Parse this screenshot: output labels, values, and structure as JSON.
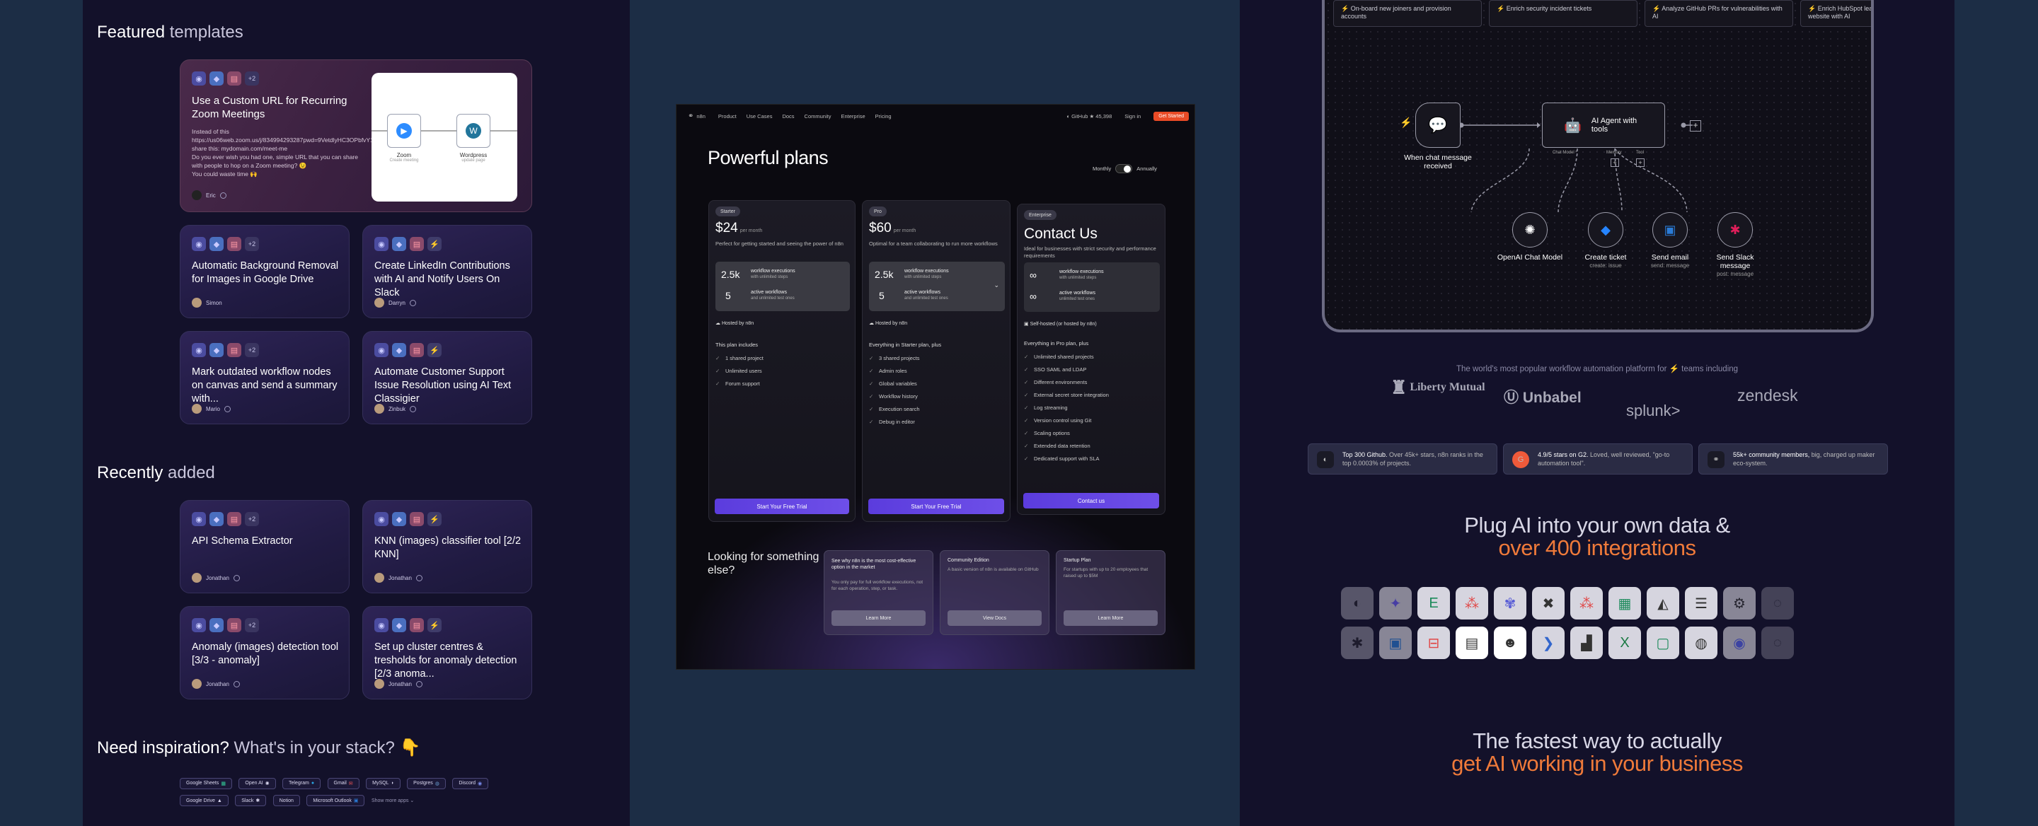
{
  "left": {
    "featured_heading": {
      "bold": "Featured",
      "rest": " templates"
    },
    "featured_card": {
      "more": "+2",
      "title": "Use a Custom URL for Recurring Zoom Meetings",
      "body": [
        "Instead of this https://us06web.zoom.us/j/834994293287pwd=9VetdlyHC3OPbfvY1i7eHC9ID46ABE.1",
        "share this: mydomain.com/meet-me",
        "Do you ever wish you had one, simple URL that you can share with people to hop on a Zoom meeting? 😉",
        "You could waste time 🙌"
      ],
      "user": "Eric",
      "nodes": [
        {
          "name": "Zoom",
          "sub": "Create meeting"
        },
        {
          "name": "Wordpress",
          "sub": "update page"
        }
      ]
    },
    "featured_cards": [
      {
        "more": "+2",
        "title": "Automatic Background Removal for Images in Google Drive",
        "user": "Simon"
      },
      {
        "more": "",
        "title": "Create LinkedIn Contributions with AI and Notify Users On Slack",
        "user": "Darryn"
      },
      {
        "more": "+2",
        "title": "Mark outdated workflow nodes on canvas and send a summary with...",
        "user": "Mario"
      },
      {
        "more": "",
        "title": "Automate Customer Support Issue Resolution using AI Text Classigier",
        "user": "Zinbuk"
      }
    ],
    "recent_heading": {
      "bold": "Recently",
      "rest": " added"
    },
    "recent_cards": [
      {
        "more": "+2",
        "title": "API Schema Extractor",
        "user": "Jonathan"
      },
      {
        "more": "",
        "title": "KNN (images) classifier tool [2/2 KNN]",
        "user": "Jonathan"
      },
      {
        "more": "+2",
        "title": "Anomaly (images) detection tool [3/3 - anomaly]",
        "user": "Jonathan"
      },
      {
        "more": "",
        "title": "Set up cluster centres & tresholds for anomaly detection [2/3 anoma...",
        "user": "Jonathan"
      }
    ],
    "inspiration_heading": {
      "bold": "Need inspiration?",
      "rest": " What's in your stack? 👇"
    },
    "tags": [
      "Google Sheets",
      "Open AI",
      "Telegram",
      "Gmail",
      "MySQL",
      "Postgres",
      "Discord",
      "Google Drive",
      "Slack",
      "Notion",
      "Microsoft Outlook"
    ],
    "show_more": "Show more apps"
  },
  "middle": {
    "nav": {
      "brand": "n8n",
      "links": [
        "Product",
        "Use Cases",
        "Docs",
        "Community",
        "Enterprise",
        "Pricing"
      ],
      "github": "GitHub ★ 45,398",
      "signin": "Sign in",
      "cta": "Get Started"
    },
    "title": "Powerful plans",
    "toggle": {
      "monthly": "Monthly",
      "annually": "Annually"
    },
    "plans": [
      {
        "badge": "Starter",
        "price": "$24",
        "per": "per month",
        "desc": "Perfect for getting started and seeing the power of n8n",
        "exec": "2.5k",
        "exec_label": "workflow executions",
        "exec_sub": "with unlimited steps",
        "active": "5",
        "active_label": "active workflows",
        "active_sub": "and unlimited test ones",
        "hosted": "Hosted by n8n",
        "feat_head": "This plan includes",
        "features": [
          "1 shared project",
          "Unlimited users",
          "Forum support"
        ],
        "cta": "Start Your Free Trial"
      },
      {
        "badge": "Pro",
        "price": "$60",
        "per": "per month",
        "desc": "Optimal for a team collaborating to run more workflows",
        "exec": "2.5k",
        "exec_label": "workflow executions",
        "exec_sub": "with unlimited steps",
        "active": "5",
        "active_label": "active workflows",
        "active_sub": "and unlimited test ones",
        "hosted": "Hosted by n8n",
        "feat_head": "Everything in Starter plan, plus",
        "features": [
          "3 shared projects",
          "Admin roles",
          "Global variables",
          "Workflow history",
          "Execution search",
          "Debug in editor"
        ],
        "cta": "Start Your Free Trial"
      },
      {
        "badge": "Enterprise",
        "price": "Contact Us",
        "per": "",
        "desc": "Ideal for businesses with strict security and performance requirements",
        "exec": "∞",
        "exec_label": "workflow executions",
        "exec_sub": "with unlimited steps",
        "active": "∞",
        "active_label": "active workflows",
        "active_sub": "unlimited test ones",
        "hosted": "Self-hosted (or hosted by n8n)",
        "feat_head": "Everything in Pro plan, plus",
        "features": [
          "Unlimited shared projects",
          "SSO SAML and LDAP",
          "Different environments",
          "External secret store integration",
          "Log streaming",
          "Version control using Git",
          "Scaling options",
          "Extended data retention",
          "Dedicated support with SLA"
        ],
        "cta": "Contact us"
      }
    ],
    "looking": "Looking for something else?",
    "alternatives": [
      {
        "title": "See why n8n is the most cost-effective option in the market",
        "desc": "You only pay for full workflow executions, not for each operation, step, or task.",
        "cta": "Learn More"
      },
      {
        "title": "Community Edition",
        "desc": "A basic version of n8n is available on GitHub",
        "cta": "View Docs"
      },
      {
        "title": "Startup Plan",
        "desc": "For startups with up to 20 employees that raised up to $5M",
        "cta": "Learn More"
      }
    ]
  },
  "right": {
    "templates": [
      "⚡ On-board new joiners and provision accounts",
      "⚡ Enrich security incident tickets",
      "⚡ Analyze GitHub PRs for vulnerabilities with AI",
      "⚡ Enrich HubSpot leads by analyzing their website with AI"
    ],
    "workflow": {
      "trigger": "When chat message received",
      "agent": "AI Agent with tools",
      "ports": [
        "Chat Model *",
        "Memory",
        "Tool"
      ],
      "tools": [
        {
          "name": "OpenAI Chat Model",
          "sub": ""
        },
        {
          "name": "Create ticket",
          "sub": "create: issue"
        },
        {
          "name": "Send email",
          "sub": "send: message"
        },
        {
          "name": "Send Slack message",
          "sub": "post: message"
        }
      ]
    },
    "trusted": "The world's most popular workflow automation platform for ⚡ teams including",
    "logos": [
      "Liberty Mutual",
      "Unbabel",
      "splunk>",
      "zendesk"
    ],
    "stats": [
      {
        "bold": "Top 300 Github.",
        "rest": " Over 45k+ stars, n8n ranks in the top 0.0003% of projects."
      },
      {
        "bold": "4.9/5 stars on G2.",
        "rest": " Loved, well reviewed, \"go-to automation tool\"."
      },
      {
        "bold": "55k+ community members,",
        "rest": " big, charged up maker eco-system."
      }
    ],
    "plug_line1": "Plug AI into your own data &",
    "plug_line2": "over 400 integrations",
    "fast_line1": "The fastest way to actually",
    "fast_line2": "get AI working in your business"
  }
}
